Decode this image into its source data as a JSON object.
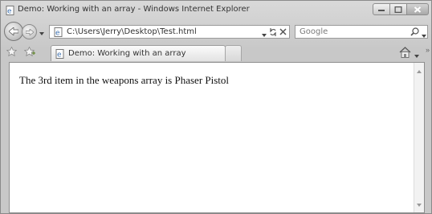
{
  "window": {
    "title": "Demo: Working with an array - Windows Internet Explorer"
  },
  "address_bar": {
    "url": "C:\\Users\\Jerry\\Desktop\\Test.html"
  },
  "search": {
    "placeholder": "Google"
  },
  "tabs": [
    {
      "label": "Demo: Working with an array"
    }
  ],
  "page": {
    "text": "The 3rd item in the weapons array is Phaser Pistol"
  },
  "icons": {
    "title": "ie-page-icon",
    "back": "back-arrow-icon",
    "forward": "forward-arrow-icon",
    "refresh": "refresh-icon",
    "stop": "stop-icon",
    "search": "magnifier-icon",
    "favorites": "star-icon",
    "add_favorites": "add-star-icon",
    "home": "home-icon"
  }
}
